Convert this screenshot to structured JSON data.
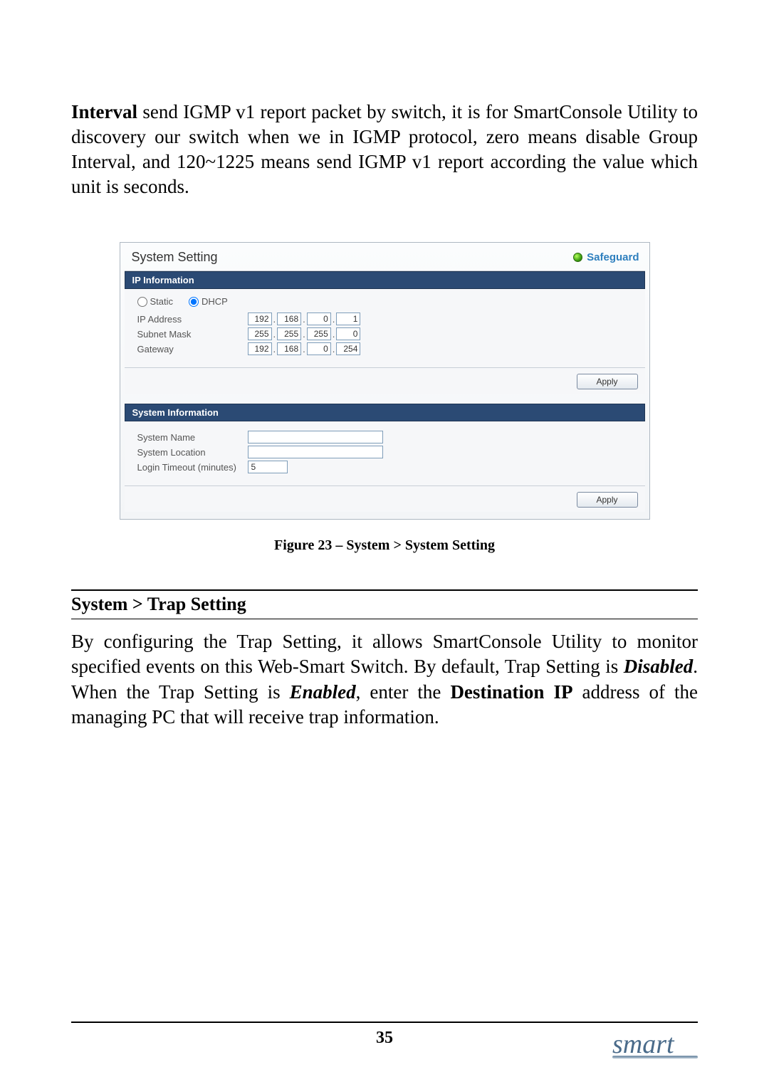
{
  "paragraph1": {
    "lead_bold": "Interval",
    "rest": " send IGMP v1 report packet by switch, it is for SmartConsole Utility to discovery our switch when we in IGMP protocol, zero means disable Group Interval, and 120~1225 means send IGMP v1 report according the value which unit is seconds."
  },
  "panel": {
    "title": "System Setting",
    "safeguard": "Safeguard",
    "ip_info": {
      "header": "IP Information",
      "static_label": "Static",
      "dhcp_label": "DHCP",
      "dhcp_selected": true,
      "rows": {
        "ip_address_label": "IP Address",
        "ip_address": [
          "192",
          "168",
          "0",
          "1"
        ],
        "subnet_label": "Subnet Mask",
        "subnet": [
          "255",
          "255",
          "255",
          "0"
        ],
        "gateway_label": "Gateway",
        "gateway": [
          "192",
          "168",
          "0",
          "254"
        ]
      },
      "apply": "Apply"
    },
    "sys_info": {
      "header": "System Information",
      "system_name_label": "System Name",
      "system_name": "",
      "system_location_label": "System Location",
      "system_location": "",
      "login_timeout_label": "Login Timeout (minutes)",
      "login_timeout": "5",
      "apply": "Apply"
    }
  },
  "figure_caption": "Figure 23 – System > System Setting",
  "section_title": "System > Trap Setting",
  "paragraph2": {
    "p1": "By configuring the Trap Setting, it allows SmartConsole Utility to monitor specified events on this Web-Smart Switch. By default, Trap Setting is ",
    "disabled": "Disabled",
    "p2": ". When the Trap Setting is ",
    "enabled": "Enabled",
    "p3": ", enter the ",
    "dest_ip": "Destination IP",
    "p4": " address of the managing PC that will receive trap information."
  },
  "page_num": "35",
  "logo": "smart"
}
